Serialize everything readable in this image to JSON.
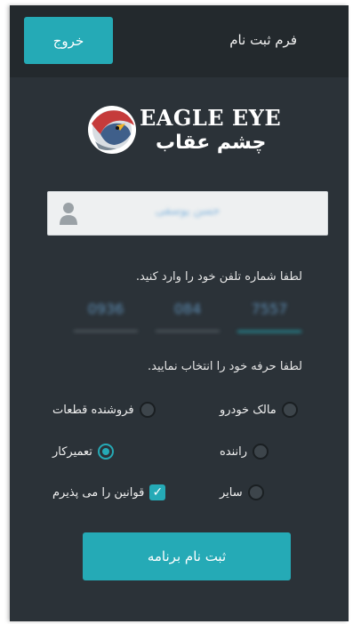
{
  "header": {
    "title": "فرم ثبت نام",
    "exit_label": "خروج"
  },
  "logo": {
    "en": "EAGLE EYE",
    "fa": "چشم عقاب"
  },
  "name_field": {
    "value": "حسن یوسفی",
    "icon": "user-icon"
  },
  "phone": {
    "label": "لطفا شماره تلفن خود را وارد کنید.",
    "parts": [
      "0936",
      "084",
      "7557"
    ]
  },
  "profession": {
    "label": "لطفا حرفه خود را انتخاب نمایید.",
    "options": [
      {
        "label": "مالک خودرو",
        "checked": false
      },
      {
        "label": "فروشنده قطعات",
        "checked": false
      },
      {
        "label": "راننده",
        "checked": false
      },
      {
        "label": "تعمیرکار",
        "checked": true
      },
      {
        "label": "سایر",
        "checked": false
      }
    ]
  },
  "terms": {
    "label": "قوانین را می پذیرم",
    "checked": true
  },
  "submit_label": "ثبت نام برنامه",
  "colors": {
    "accent": "#25aab6",
    "background": "#2b3238",
    "header": "#23292d"
  }
}
